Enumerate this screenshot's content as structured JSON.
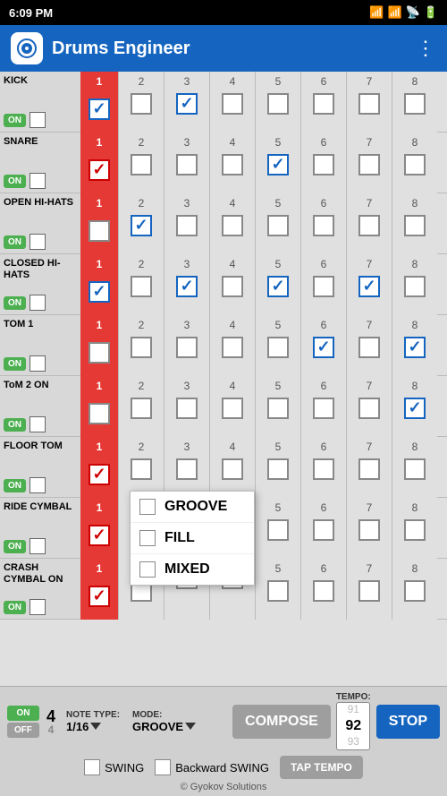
{
  "statusBar": {
    "time": "6:09 PM",
    "signal1": "▎▎▎",
    "signal2": "▎▎▎",
    "wifi": "WiFi",
    "battery": "Battery"
  },
  "header": {
    "title": "Drums Engineer",
    "menuIcon": "⋮"
  },
  "rows": [
    {
      "id": "kick",
      "label": "KICK",
      "on": true,
      "beats": {
        "1": true,
        "2": false,
        "3": true,
        "4": false,
        "5": false,
        "6": false,
        "7": false,
        "8": false
      }
    },
    {
      "id": "snare",
      "label": "SNARE",
      "on": true,
      "beats": {
        "1": false,
        "2": false,
        "3": false,
        "4": false,
        "5": true,
        "6": false,
        "7": false,
        "8": false
      }
    },
    {
      "id": "open-hi-hats",
      "label": "OPEN HI-HATS",
      "on": true,
      "beats": {
        "1": false,
        "2": true,
        "3": false,
        "4": false,
        "5": false,
        "6": false,
        "7": false,
        "8": false
      }
    },
    {
      "id": "closed-hi-hats",
      "label": "CLOSED HI-HATS",
      "on": true,
      "beats": {
        "1": true,
        "2": false,
        "3": true,
        "4": false,
        "5": true,
        "6": false,
        "7": true,
        "8": false
      }
    },
    {
      "id": "tom1",
      "label": "TOM 1",
      "on": true,
      "beats": {
        "1": false,
        "2": false,
        "3": false,
        "4": false,
        "5": false,
        "6": true,
        "7": false,
        "8": true
      }
    },
    {
      "id": "tom2",
      "label": "ToM 2 ON",
      "on": true,
      "beats": {
        "1": false,
        "2": false,
        "3": false,
        "4": false,
        "5": false,
        "6": false,
        "7": false,
        "8": true
      }
    },
    {
      "id": "floor-tom",
      "label": "FLOOR TOM",
      "on": true,
      "beats": {
        "1": false,
        "2": false,
        "3": false,
        "4": false,
        "5": false,
        "6": false,
        "7": false,
        "8": false
      }
    },
    {
      "id": "ride-cymbal",
      "label": "RIDE CYMBAL",
      "on": true,
      "beats": {
        "1": false,
        "2": false,
        "3": false,
        "4": false,
        "5": false,
        "6": false,
        "7": false,
        "8": false
      }
    },
    {
      "id": "crash-cymbal",
      "label": "CRASH CYMBAL ON",
      "on": true,
      "beats": {
        "1": false,
        "2": false,
        "3": false,
        "4": false,
        "5": false,
        "6": false,
        "7": false,
        "8": false
      }
    }
  ],
  "dropdown": {
    "items": [
      "GROOVE",
      "FILL",
      "MIXED"
    ]
  },
  "bottomToolbar": {
    "onLabel": "ON",
    "offLabel": "OFF",
    "timeSig": "4/4",
    "noteTypeLabel": "NOTE TYPE:",
    "noteTypeValue": "1/16",
    "modeLabel": "MODE:",
    "modeValue": "GROOVE",
    "composeLabel": "COMPOSE",
    "tempoLabel": "TEMPO:",
    "tempoValues": [
      "91",
      "92",
      "93"
    ],
    "tempoActive": "92",
    "stopLabel": "STOP",
    "swingLabel": "SWING",
    "backwardSwingLabel": "Backward SWING",
    "tapTempoLabel": "TAP TEMPO",
    "copyright": "© Gyokov Solutions"
  }
}
